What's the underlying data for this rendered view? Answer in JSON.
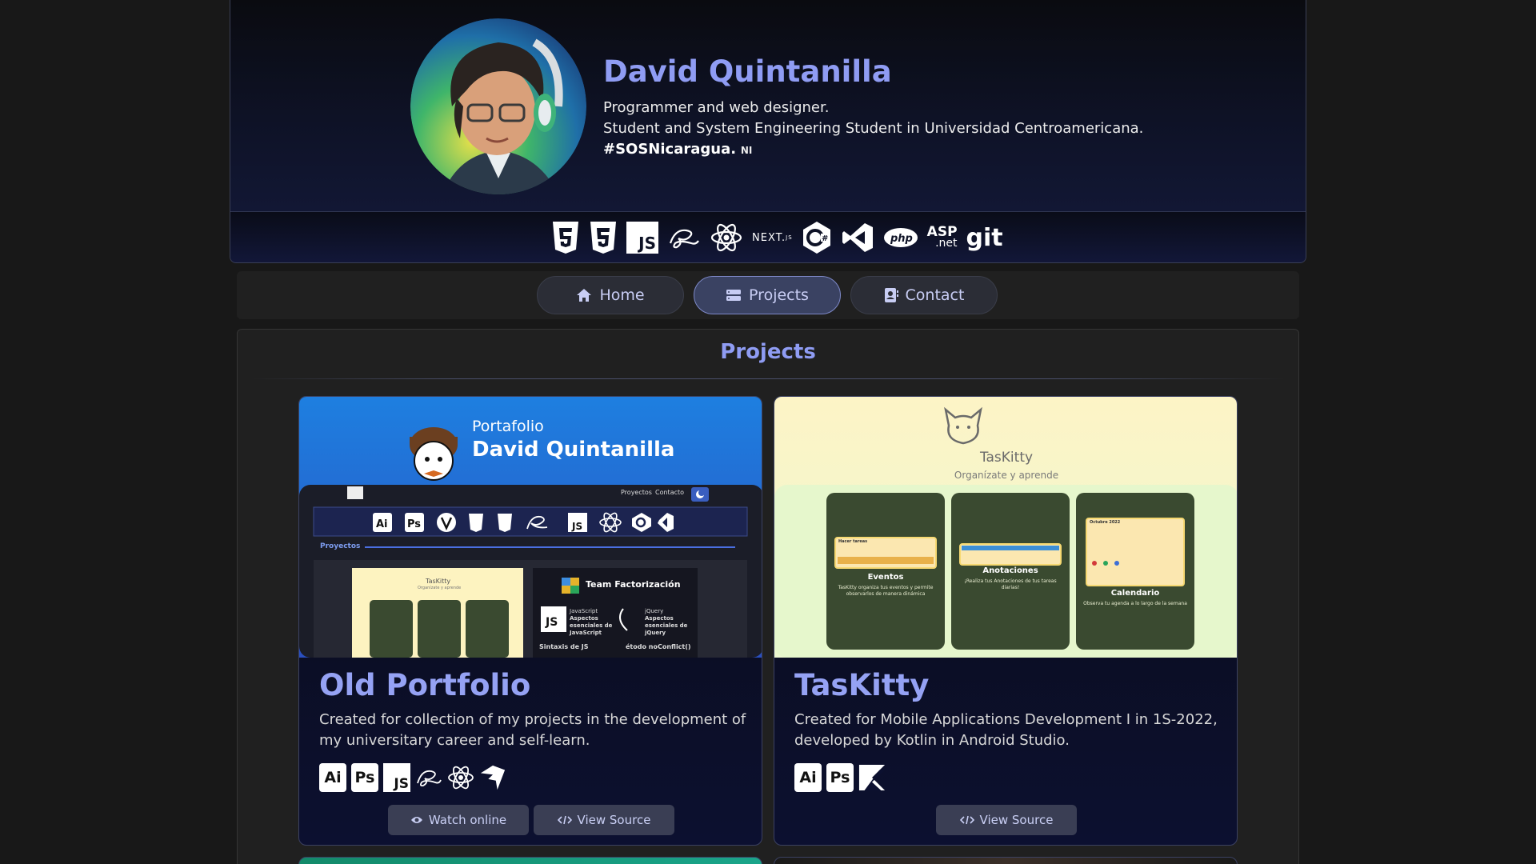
{
  "profile": {
    "name": "David Quintanilla",
    "line1": "Programmer and web designer.",
    "line2": "Student and System Engineering Student in Universidad Centroamericana.",
    "tag": "#SOSNicaragua.",
    "flag": "NI"
  },
  "tech_icons": [
    "html5-icon",
    "css3-icon",
    "javascript-icon",
    "sass-icon",
    "react-icon",
    "nextjs-icon",
    "csharp-icon",
    "visual-studio-icon",
    "php-icon",
    "aspnet-icon",
    "git-icon"
  ],
  "tech_labels": {
    "js": "JS",
    "next": "NEXT.",
    "next_sub": "JS",
    "php": "php",
    "asp": "ASP",
    "net": ".net",
    "git": "git"
  },
  "nav": {
    "home": "Home",
    "projects": "Projects",
    "contact": "Contact"
  },
  "section_title": "Projects",
  "cards": [
    {
      "title": "Old Portfolio",
      "description": "Created for collection of my projects in the development of my universitary career and self-learn.",
      "icons": [
        "illustrator-icon",
        "photoshop-icon",
        "javascript-icon",
        "sass-icon",
        "react-icon",
        "vite-icon"
      ],
      "watch_label": "Watch online",
      "source_label": "View Source",
      "preview": {
        "small": "Portafolio",
        "big": "David Quintanilla",
        "nav_projects": "Proyectos",
        "nav_contact": "Contacto",
        "section": "Proyectos",
        "mini_card": "TasKitty",
        "mini_card_sub": "Organízate y aprende",
        "team": "Team Factorización",
        "js_lbl1": "JavaScript",
        "js_lbl2": "Aspectos esenciales de JavaScript",
        "jq_lbl1": "jQuery",
        "jq_lbl2": "Aspectos esenciales de jQuery",
        "row1": "Sintaxis de JS",
        "row2": "étodo noConflict()"
      }
    },
    {
      "title": "TasKitty",
      "description": "Created for Mobile Applications Development I in 1S-2022, developed by Kotlin in Android Studio.",
      "icons": [
        "illustrator-icon",
        "photoshop-icon",
        "kotlin-icon"
      ],
      "source_label": "View Source",
      "preview": {
        "app": "TasKitty",
        "subtitle": "Organízate y aprende",
        "s1_title": "Eventos",
        "s1_desc": "TasKitty organiza tus eventos y permite observarlos de manera dinámica",
        "s1_header": "Hacer tareas",
        "s2_title": "Anotaciones",
        "s2_desc": "¡Realiza tus Anotaciones de tus tareas diarias!",
        "s3_title": "Calendario",
        "s3_desc": "Observa tu agenda a lo largo de la semana",
        "s3_month": "Octubre 2022"
      }
    }
  ],
  "colors": {
    "accent": "#8f9cf3",
    "background": "#181818",
    "panel": "#202020"
  }
}
